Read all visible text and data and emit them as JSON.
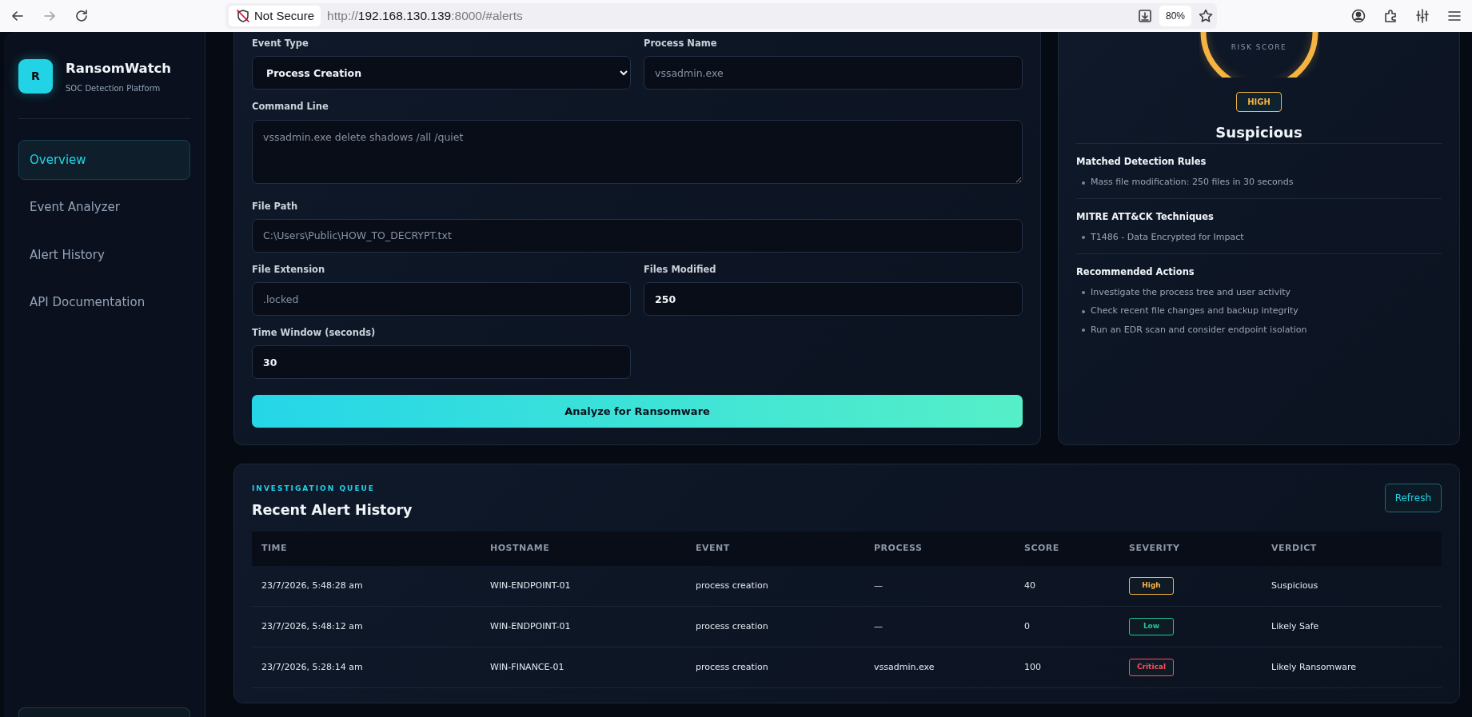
{
  "browser": {
    "not_secure": "Not Secure",
    "url": {
      "scheme": "http://",
      "host": "192.168.130.139",
      "rest": ":8000/#alerts"
    },
    "zoom": "80%"
  },
  "sidebar": {
    "logo": "R",
    "title": "RansomWatch",
    "subtitle": "SOC Detection Platform",
    "items": [
      {
        "label": "Overview",
        "selected": true
      },
      {
        "label": "Event Analyzer",
        "selected": false
      },
      {
        "label": "Alert History",
        "selected": false
      },
      {
        "label": "API Documentation",
        "selected": false
      }
    ]
  },
  "form": {
    "fields": [
      {
        "kind": "select",
        "label": "Event Type",
        "value": "Process Creation",
        "full": false
      },
      {
        "kind": "text",
        "label": "Process Name",
        "placeholder": "vssadmin.exe",
        "full": false
      },
      {
        "kind": "textarea",
        "label": "Command Line",
        "placeholder": "vssadmin.exe delete shadows /all /quiet",
        "full": true
      },
      {
        "kind": "text",
        "label": "File Path",
        "placeholder": "C:\\Users\\Public\\HOW_TO_DECRYPT.txt",
        "full": true
      },
      {
        "kind": "text",
        "label": "File Extension",
        "placeholder": ".locked",
        "full": false
      },
      {
        "kind": "number",
        "label": "Files Modified",
        "value": "250",
        "full": false
      },
      {
        "kind": "number",
        "label": "Time Window (seconds)",
        "value": "30",
        "full": false
      }
    ],
    "submit": "Analyze for Ransomware"
  },
  "result": {
    "risk_label": "RISK SCORE",
    "severity": {
      "text": "HIGH",
      "color": "#f5b342"
    },
    "verdict": "Suspicious",
    "sections": [
      {
        "title": "Matched Detection Rules",
        "items": [
          "Mass file modification: 250 files in 30 seconds"
        ]
      },
      {
        "title": "MITRE ATT&CK Techniques",
        "items": [
          "T1486 - Data Encrypted for Impact"
        ]
      },
      {
        "title": "Recommended Actions",
        "items": [
          "Investigate the process tree and user activity",
          "Check recent file changes and backup integrity",
          "Run an EDR scan and consider endpoint isolation"
        ]
      }
    ]
  },
  "alerts": {
    "eyebrow": "INVESTIGATION QUEUE",
    "title": "Recent Alert History",
    "refresh": "Refresh",
    "columns": [
      "TIME",
      "HOSTNAME",
      "EVENT",
      "PROCESS",
      "SCORE",
      "SEVERITY",
      "VERDICT"
    ],
    "rows": [
      {
        "cells": [
          "23/7/2026, 5:48:28 am",
          "WIN-ENDPOINT-01",
          "process creation",
          "—",
          "40"
        ],
        "severity": {
          "text": "High",
          "color": "#f5b342"
        },
        "verdict": "Suspicious"
      },
      {
        "cells": [
          "23/7/2026, 5:48:12 am",
          "WIN-ENDPOINT-01",
          "process creation",
          "—",
          "0"
        ],
        "severity": {
          "text": "Low",
          "color": "#22c98e"
        },
        "verdict": "Likely Safe"
      },
      {
        "cells": [
          "23/7/2026, 5:28:14 am",
          "WIN-FINANCE-01",
          "process creation",
          "vssadmin.exe",
          "100"
        ],
        "severity": {
          "text": "Critical",
          "color": "#ff4d5e"
        },
        "verdict": "Likely Ransomware"
      }
    ]
  }
}
